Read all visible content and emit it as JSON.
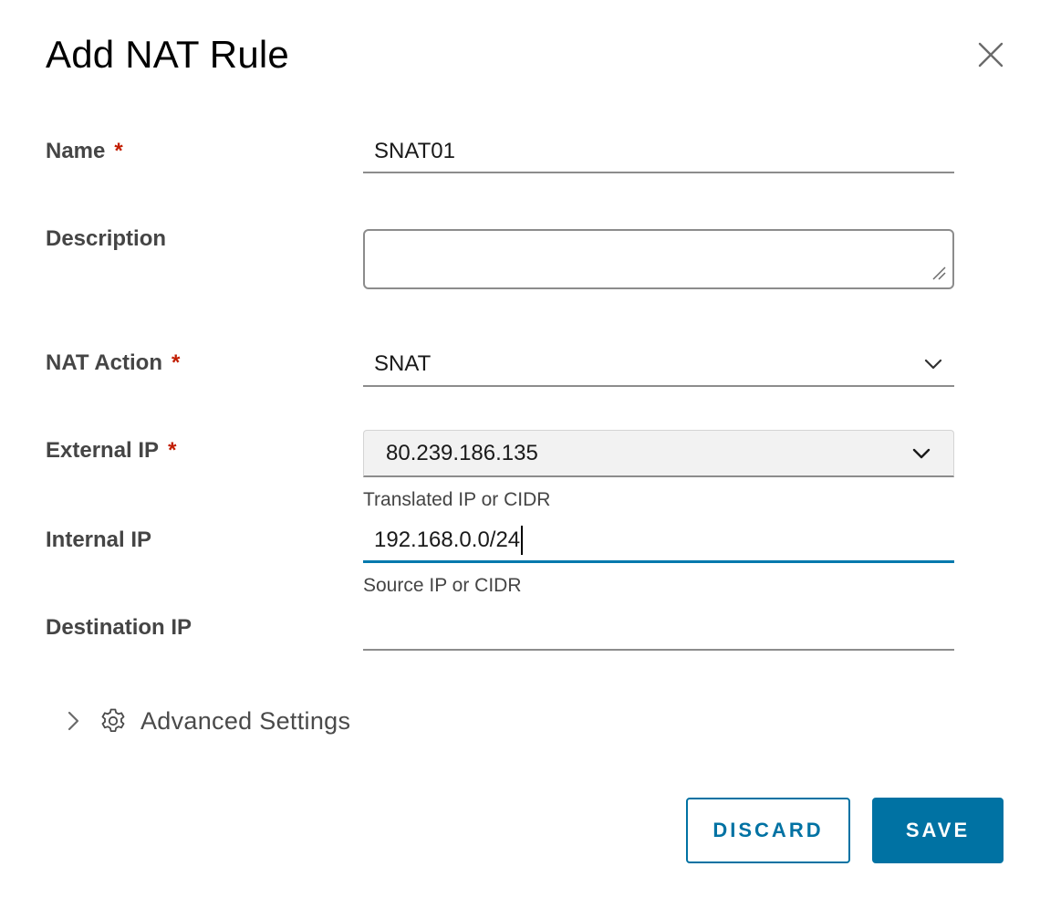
{
  "dialog": {
    "title": "Add NAT Rule"
  },
  "form": {
    "name": {
      "label": "Name",
      "required_mark": "*",
      "value": "SNAT01"
    },
    "description": {
      "label": "Description",
      "value": ""
    },
    "nat_action": {
      "label": "NAT Action",
      "required_mark": "*",
      "selected": "SNAT"
    },
    "external_ip": {
      "label": "External IP",
      "required_mark": "*",
      "selected": "80.239.186.135",
      "helper": "Translated IP or CIDR"
    },
    "internal_ip": {
      "label": "Internal IP",
      "value": "192.168.0.0/24",
      "helper": "Source IP or CIDR"
    },
    "destination_ip": {
      "label": "Destination IP",
      "value": ""
    }
  },
  "advanced": {
    "label": "Advanced Settings"
  },
  "buttons": {
    "discard": "DISCARD",
    "save": "SAVE"
  },
  "colors": {
    "primary": "#0072a3",
    "required": "#c21d00",
    "focus_underline": "#0079ad"
  }
}
